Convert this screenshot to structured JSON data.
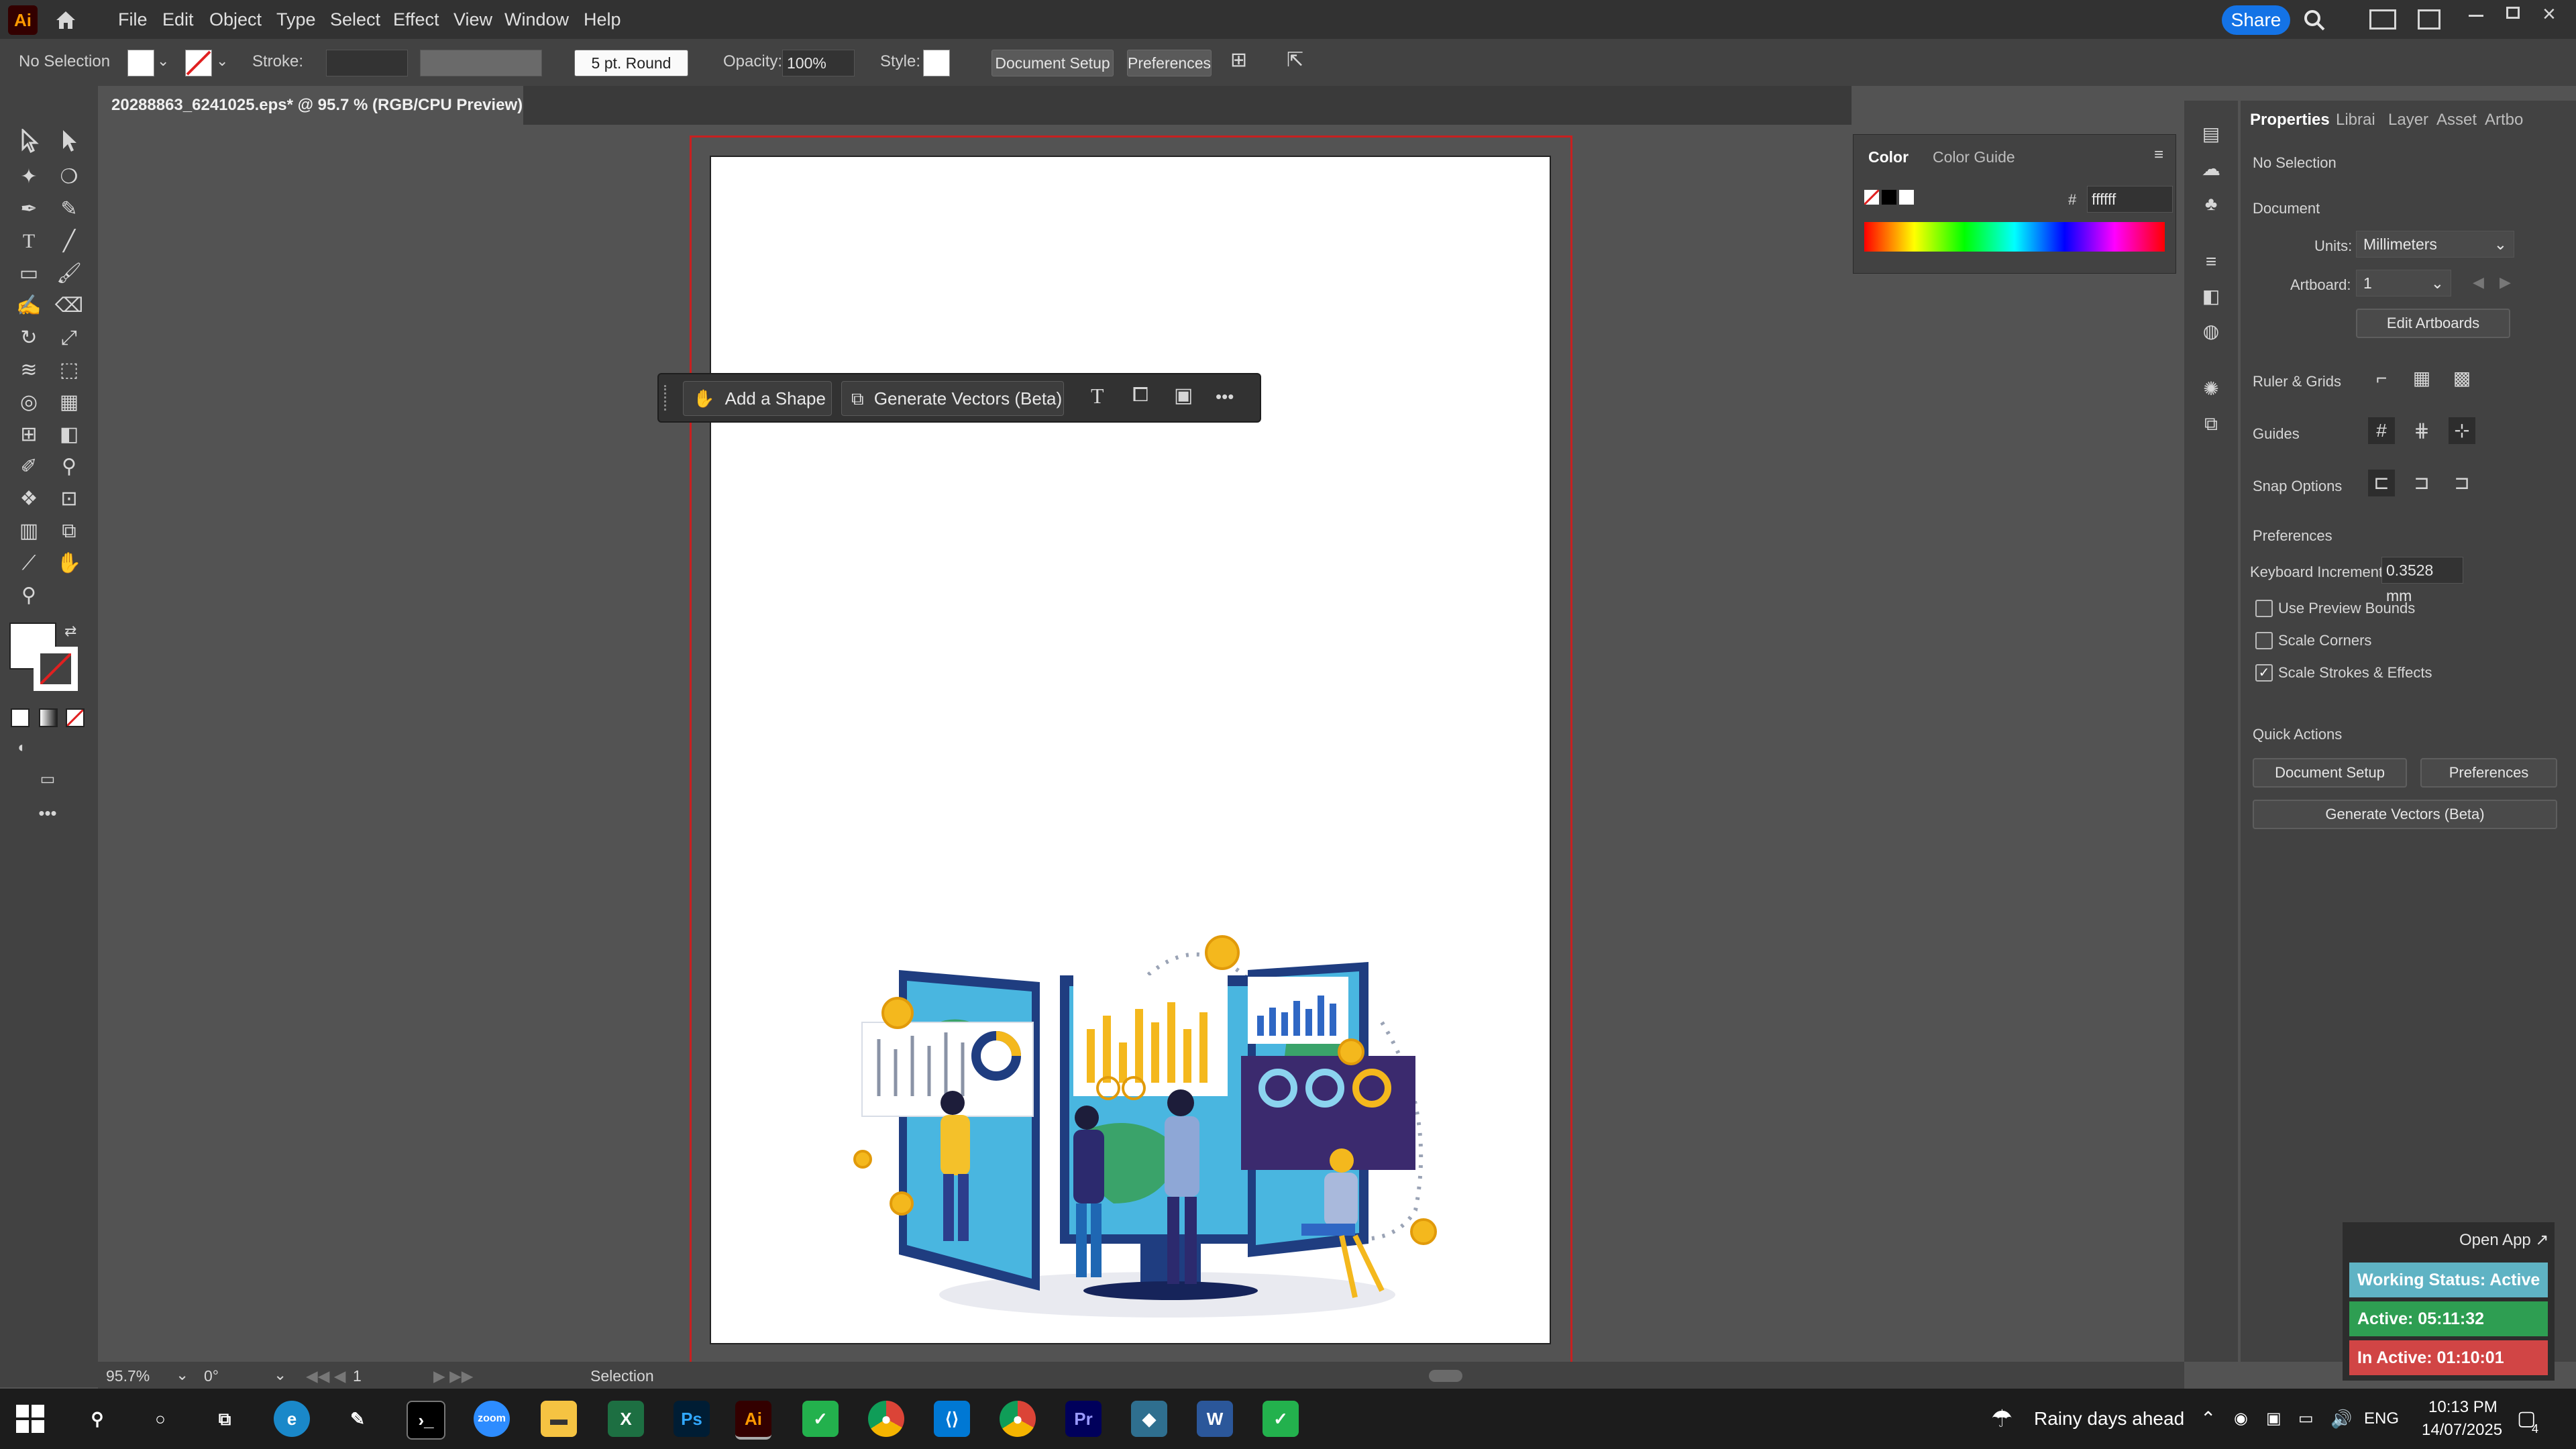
{
  "app": {
    "logo": "Ai",
    "share_label": "Share"
  },
  "menus": [
    "File",
    "Edit",
    "Object",
    "Type",
    "Select",
    "Effect",
    "View",
    "Window",
    "Help"
  ],
  "control_bar": {
    "selection": "No Selection",
    "stroke_label": "Stroke:",
    "brush": "5 pt. Round",
    "opacity_label": "Opacity:",
    "opacity_value": "100%",
    "style_label": "Style:",
    "document_setup": "Document Setup",
    "preferences": "Preferences"
  },
  "document_tab": {
    "title": "20288863_6241025.eps* @ 95.7 % (RGB/CPU Preview)",
    "close": "×"
  },
  "contextual_bar": {
    "add_shape": "Add a Shape",
    "generate_vectors": "Generate Vectors (Beta)",
    "more": "•••"
  },
  "color_panel": {
    "tabs": [
      "Color",
      "Color Guide"
    ],
    "hex_label": "#",
    "hex_value": "ffffff"
  },
  "properties": {
    "tabs": [
      "Properties",
      "Librai",
      "Layer",
      "Asset",
      "Artbo"
    ],
    "selection": "No Selection",
    "document_heading": "Document",
    "units_label": "Units:",
    "units_value": "Millimeters",
    "artboard_label": "Artboard:",
    "artboard_value": "1",
    "edit_artboards": "Edit Artboards",
    "ruler_grids": "Ruler & Grids",
    "guides": "Guides",
    "snap_options": "Snap Options",
    "preferences_heading": "Preferences",
    "keyboard_increment_label": "Keyboard Increment:",
    "keyboard_increment_value": "0.3528 mm",
    "checkboxes": [
      {
        "label": "Use Preview Bounds",
        "checked": false
      },
      {
        "label": "Scale Corners",
        "checked": false
      },
      {
        "label": "Scale Strokes & Effects",
        "checked": true
      }
    ],
    "quick_actions_heading": "Quick Actions",
    "qa_document_setup": "Document Setup",
    "qa_preferences": "Preferences",
    "qa_generate_vectors": "Generate Vectors (Beta)"
  },
  "status_bar": {
    "zoom": "95.7%",
    "rotation": "0°",
    "artboard": "1",
    "tool": "Selection"
  },
  "widget": {
    "open_app": "Open App ↗",
    "working_status": "Working Status: Active",
    "active": "Active: 05:11:32",
    "inactive": "In Active: 01:10:01",
    "colors": {
      "working": "#5fb3c4",
      "active": "#2e9e52",
      "inactive": "#d14545"
    }
  },
  "taskbar": {
    "weather": "Rainy days ahead",
    "language": "ENG",
    "time": "10:13 PM",
    "date": "14/07/2025",
    "notifications": "4"
  },
  "icons": [
    "home-icon",
    "search-icon",
    "arrange-icon",
    "selection-icon",
    "pen-icon",
    "type-icon",
    "rectangle-icon",
    "brush-icon",
    "hand-icon",
    "zoom-icon"
  ]
}
